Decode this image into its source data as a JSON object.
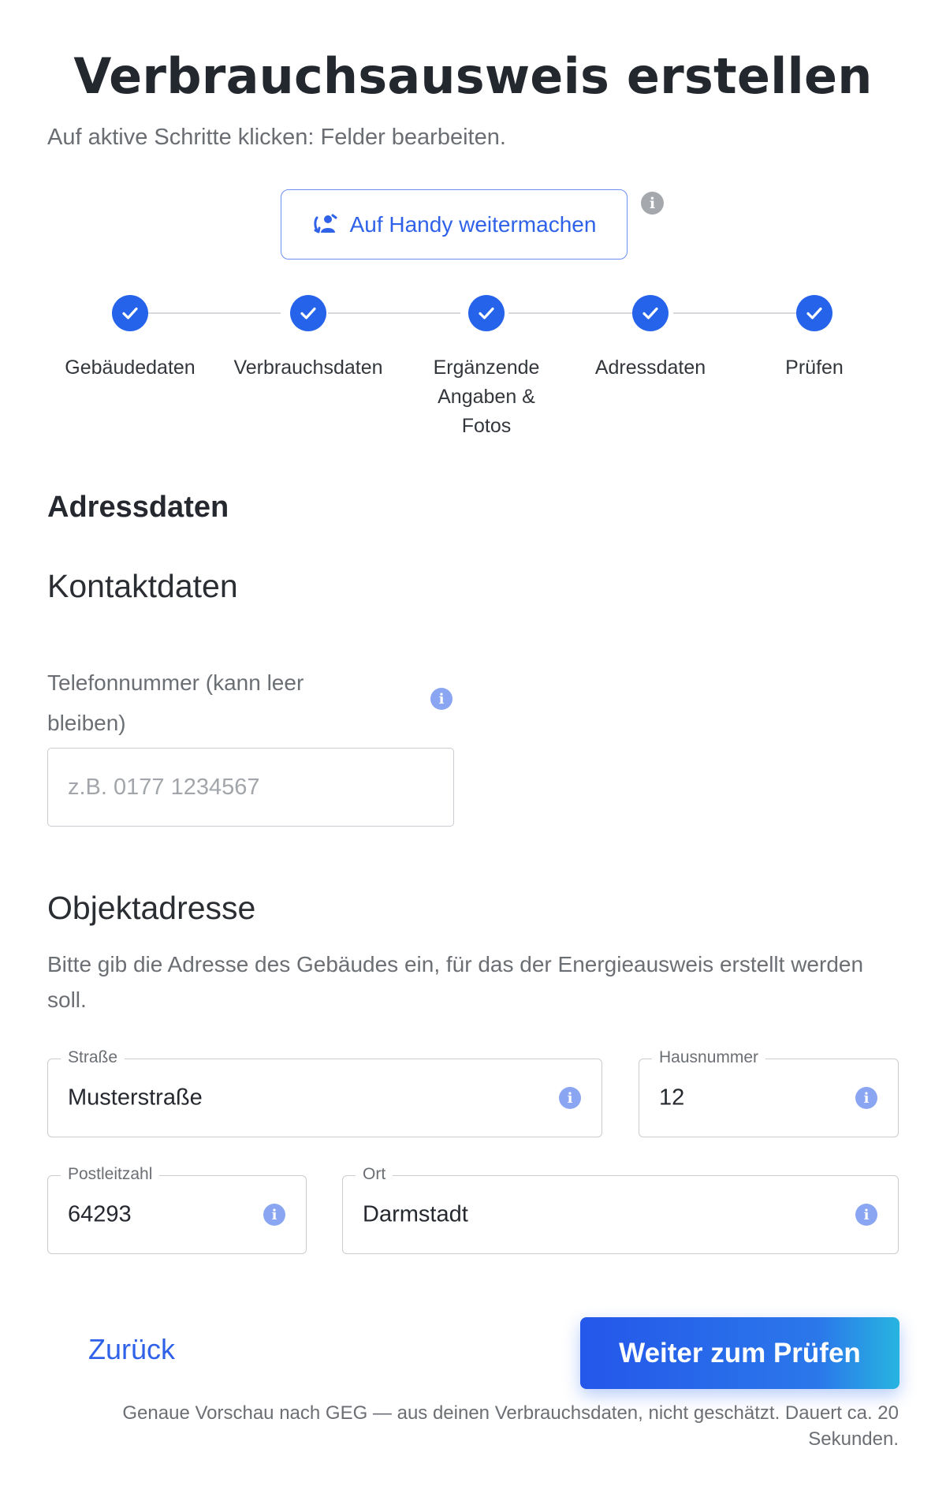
{
  "header": {
    "title": "Verbrauchsausweis erstellen",
    "subtitle": "Auf aktive Schritte klicken: Felder bearbeiten."
  },
  "handy_button": {
    "label": "Auf Handy weitermachen",
    "icon": "phone-handoff-icon"
  },
  "steps": [
    {
      "label": "Gebäudedaten",
      "status": "completed"
    },
    {
      "label": "Verbrauchsdaten",
      "status": "completed"
    },
    {
      "label": "Ergänzende\nAngaben &\nFotos",
      "status": "completed"
    },
    {
      "label": "Adressdaten",
      "status": "completed"
    },
    {
      "label": "Prüfen",
      "status": "completed"
    }
  ],
  "section": {
    "title": "Adressdaten",
    "contact": {
      "title": "Kontaktdaten",
      "phone_label": "Telefonnummer (kann leer bleiben)",
      "phone_placeholder": "z.B. 0177 1234567",
      "phone_value": ""
    },
    "object": {
      "title": "Objektadresse",
      "description": "Bitte gib die Adresse des Gebäudes ein, für das der Energieausweis erstellt werden soll.",
      "street": {
        "label": "Straße",
        "value": "Musterstraße"
      },
      "house_number": {
        "label": "Hausnummer",
        "value": "12"
      },
      "postal_code": {
        "label": "Postleitzahl",
        "value": "64293"
      },
      "city": {
        "label": "Ort",
        "value": "Darmstadt"
      }
    }
  },
  "actions": {
    "back_label": "Zurück",
    "next_label": "Weiter zum Prüfen",
    "footnote": "Genaue Vorschau nach GEG — aus deinen Verbrauchsdaten, nicht geschätzt. Dauert ca. 20 Sekunden."
  },
  "colors": {
    "accent": "#2563eb",
    "step_line": "#d7d9dd",
    "info_icon": "#8aa6f2"
  }
}
